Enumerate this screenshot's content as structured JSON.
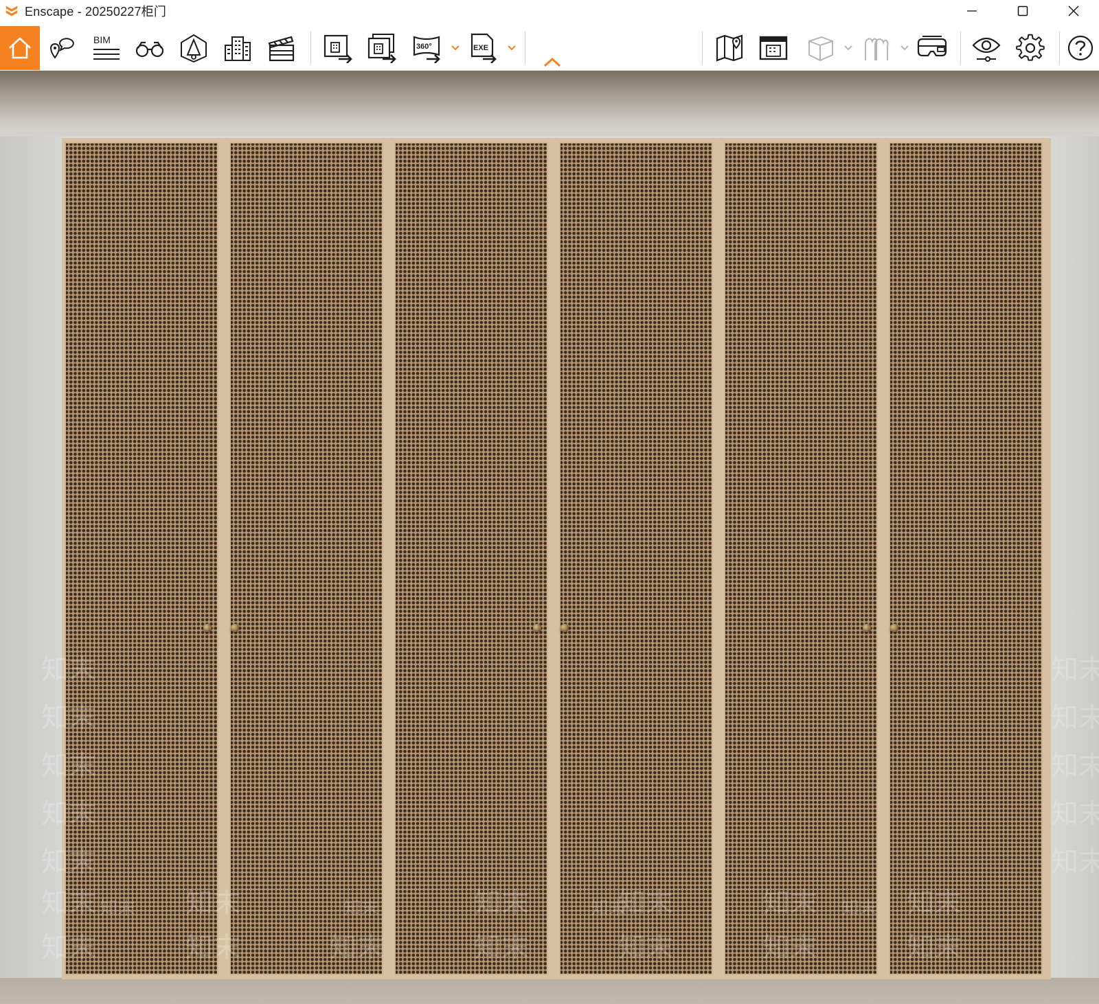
{
  "window": {
    "title": "Enscape - 20250227柜门",
    "controls": {
      "minimize_icon": "minimize-icon",
      "maximize_icon": "maximize-icon",
      "close_icon": "close-icon"
    }
  },
  "theme": {
    "accent": "#f58220",
    "icon_color": "#1e1e1e",
    "disabled_icon_color": "#b5b5b5"
  },
  "toolbar": {
    "items": [
      {
        "id": "home",
        "icon": "home-icon",
        "active": true
      },
      {
        "id": "views",
        "icon": "location-bubbles-icon"
      },
      {
        "id": "bim",
        "icon": "bim-icon",
        "label": "BIM"
      },
      {
        "id": "binoculars",
        "icon": "binoculars-icon"
      },
      {
        "id": "atmosphere",
        "icon": "atmosphere-icon"
      },
      {
        "id": "asset-library",
        "icon": "buildings-icon"
      },
      {
        "id": "video-editor",
        "icon": "clapperboard-icon"
      },
      {
        "id": "render-image",
        "icon": "export-image-icon"
      },
      {
        "id": "batch-render",
        "icon": "batch-export-icon"
      },
      {
        "id": "panorama",
        "icon": "panorama-360-icon",
        "label": "360°",
        "dropdown": true
      },
      {
        "id": "export-exe",
        "icon": "export-exe-icon",
        "label": "EXE",
        "dropdown": true
      },
      {
        "id": "collapse",
        "icon": "chevron-up-icon"
      },
      {
        "id": "map",
        "icon": "map-icon"
      },
      {
        "id": "minimap",
        "icon": "minimap-icon"
      },
      {
        "id": "section-box",
        "icon": "cube-icon",
        "dropdown": true,
        "disabled": true
      },
      {
        "id": "people",
        "icon": "people-icon",
        "dropdown": true,
        "disabled": true
      },
      {
        "id": "vr",
        "icon": "vr-headset-icon"
      },
      {
        "id": "visual-settings",
        "icon": "eye-icon"
      },
      {
        "id": "settings",
        "icon": "gear-icon"
      },
      {
        "id": "help",
        "icon": "help-icon"
      }
    ]
  },
  "viewport": {
    "scene": "rendered-wardrobe",
    "doors": 6,
    "watermark_text": "知末"
  }
}
